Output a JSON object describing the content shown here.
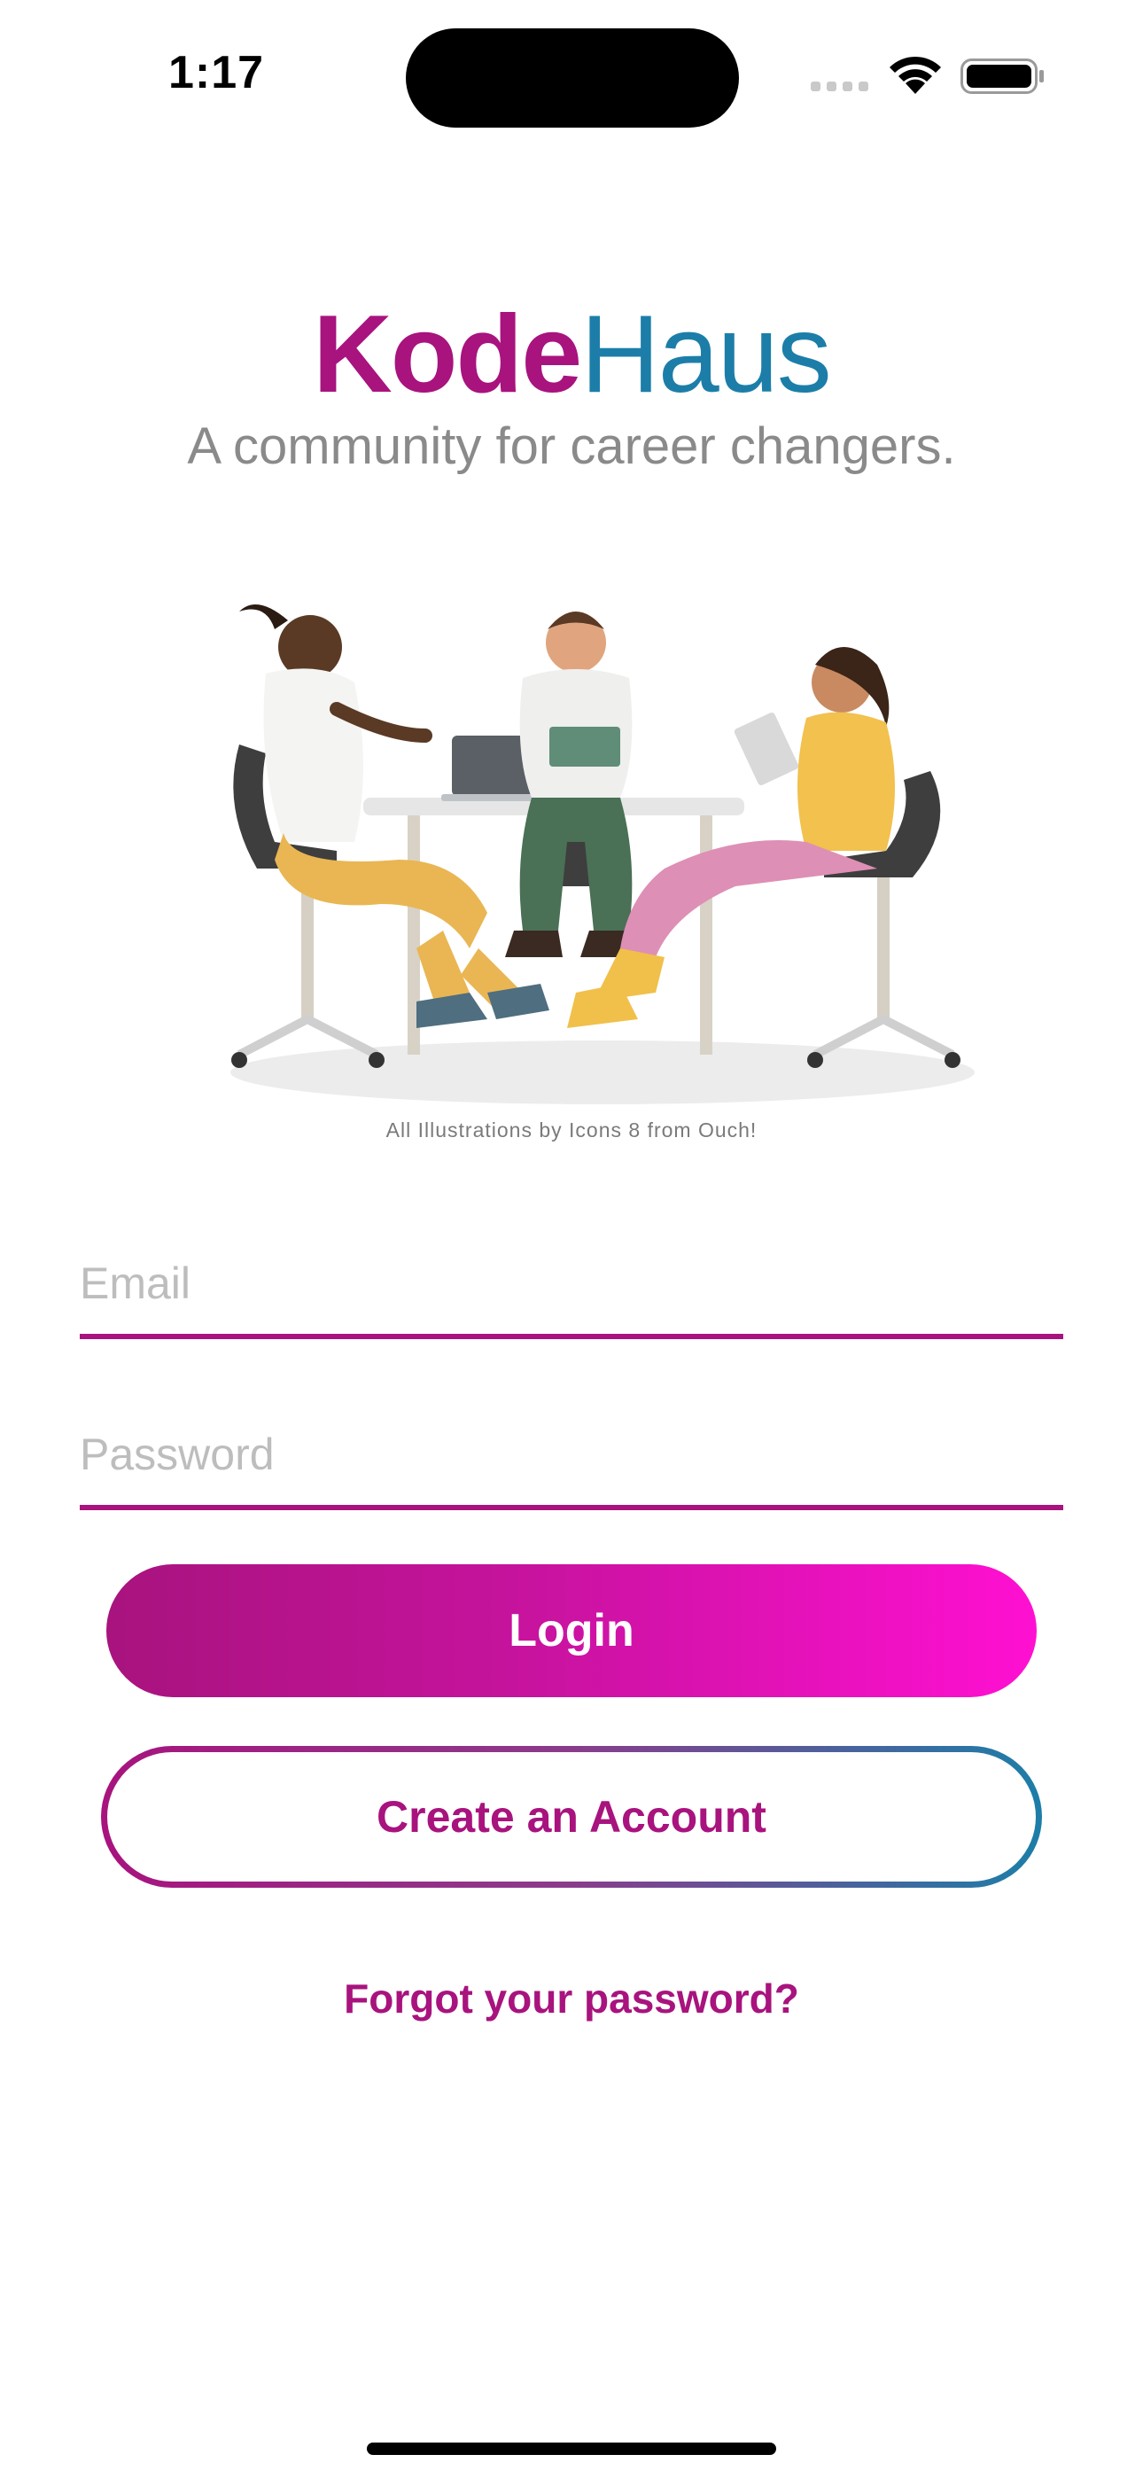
{
  "status_bar": {
    "time": "1:17",
    "icons": [
      "signal-icon",
      "wifi-icon",
      "battery-icon"
    ]
  },
  "brand": {
    "part1": "Kode",
    "part2": "Haus",
    "tagline": "A community for career changers."
  },
  "illustration": {
    "credit": "All Illustrations by Icons 8 from Ouch!"
  },
  "form": {
    "email_placeholder": "Email",
    "email_value": "",
    "password_placeholder": "Password",
    "password_value": ""
  },
  "actions": {
    "login_label": "Login",
    "create_label": "Create an Account",
    "forgot_label": "Forgot your password?"
  },
  "colors": {
    "brand_magenta": "#A8137E",
    "brand_blue": "#1C7EA8",
    "login_gradient_end": "#FF10D2"
  }
}
